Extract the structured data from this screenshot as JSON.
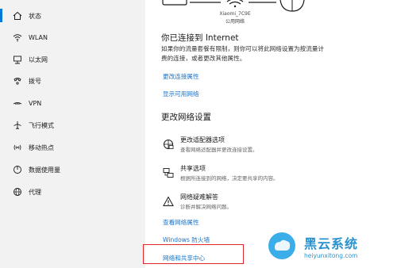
{
  "sidebar": {
    "items": [
      {
        "label": "状态",
        "icon": "home-icon"
      },
      {
        "label": "WLAN",
        "icon": "wifi-icon"
      },
      {
        "label": "以太网",
        "icon": "ethernet-icon"
      },
      {
        "label": "拨号",
        "icon": "phone-icon"
      },
      {
        "label": "VPN",
        "icon": "vpn-icon"
      },
      {
        "label": "飞行模式",
        "icon": "airplane-icon"
      },
      {
        "label": "移动热点",
        "icon": "hotspot-icon"
      },
      {
        "label": "数据使用量",
        "icon": "data-usage-icon"
      },
      {
        "label": "代理",
        "icon": "globe-icon"
      }
    ],
    "selected_index": 0,
    "accent_color": "#0078d7"
  },
  "network": {
    "ssid": "Xiaomi_7C9E",
    "type": "公用网络"
  },
  "connected": {
    "heading": "你已连接到 Internet",
    "description_line1": "如果你的流量套餐有限制，则你可以将此网络设置为按流量计",
    "description_line2": "费的连接，或者更改其他属性。",
    "links": {
      "change_properties": "更改连接属性",
      "show_networks": "显示可用网络"
    }
  },
  "change_settings": {
    "heading": "更改网络设置",
    "items": [
      {
        "title": "更改适配器选项",
        "description": "查看网络适配器并更改连接设置。",
        "icon": "adapter-icon"
      },
      {
        "title": "共享选项",
        "description": "根据所连接到的网络，决定要共享的内容。",
        "icon": "sharing-icon"
      },
      {
        "title": "网络疑难解答",
        "description": "诊断并解决网络问题。",
        "icon": "warning-icon"
      }
    ]
  },
  "bottom_links": {
    "view_properties": "查看网络属性",
    "firewall": "Windows 防火墙",
    "sharing_center": "网络和共享中心"
  },
  "watermark": {
    "title": "黑云系统",
    "url": "heiyunxitong.com"
  },
  "colors": {
    "link": "#1a73c8",
    "highlight": "#e3262b"
  }
}
